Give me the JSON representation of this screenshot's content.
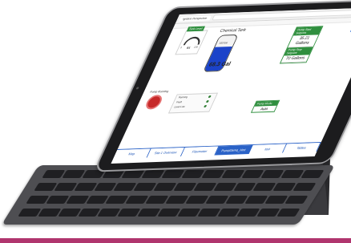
{
  "browser": {
    "tab_label": "Ignition Perspective"
  },
  "hmi": {
    "gauge": {
      "title": "Tank Level",
      "value": "64",
      "min": "0",
      "max": "100"
    },
    "tank": {
      "title": "Chemical Tank",
      "level_label": "68.3 Gal",
      "max_label": "100 Gal",
      "fill_fraction": 0.68
    },
    "pump_start": {
      "header": "Pump Start Setpoint",
      "value": "35.21 Gallons"
    },
    "pump_stop": {
      "header": "Pump Stop Setpoint",
      "value": "70 Gallons"
    },
    "alarm": {
      "title": "Pump Running",
      "rows": [
        "Running",
        "Fault",
        "Level Low"
      ]
    },
    "mode": {
      "header": "Pump Mode",
      "value": "Auto"
    }
  },
  "nav_icons": [
    "home-icon",
    "page-icon"
  ],
  "tabs": [
    {
      "label": "Map"
    },
    {
      "label": "Site 1 Overview"
    },
    {
      "label": "Flowmeter"
    },
    {
      "label": "PumpDemo_Hmi",
      "active": true
    },
    {
      "label": "test"
    },
    {
      "label": "Tables"
    }
  ],
  "colors": {
    "accent_green": "#2f8f3e",
    "tank_fill": "#1b43c9",
    "nav_blue": "#2a62c7",
    "alarm_red": "#c62828",
    "page_border": "#b0356e"
  }
}
